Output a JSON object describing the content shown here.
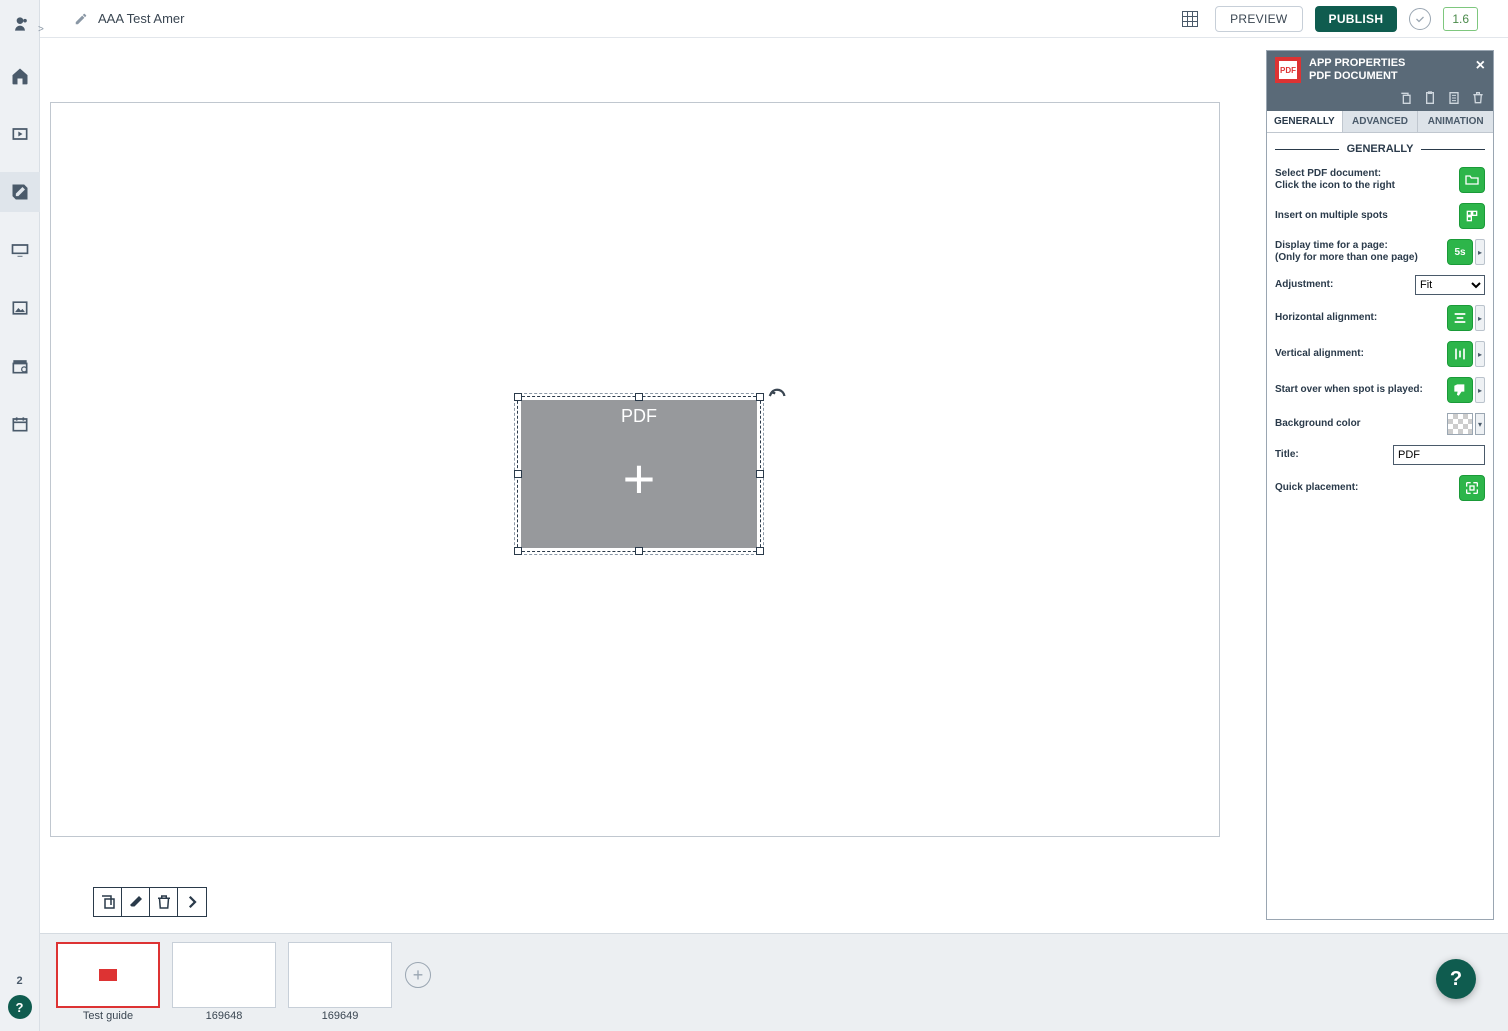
{
  "topbar": {
    "doc_title": "AAA Test Amer",
    "preview_label": "PREVIEW",
    "publish_label": "PUBLISH",
    "version": "1.6"
  },
  "sidebar": {
    "badge": "2"
  },
  "canvas": {
    "element_label": "PDF"
  },
  "spots": [
    {
      "label": "Test guide",
      "active": true,
      "has_pdf": true
    },
    {
      "label": "169648",
      "active": false,
      "has_pdf": false
    },
    {
      "label": "169649",
      "active": false,
      "has_pdf": false
    }
  ],
  "props": {
    "header_line1": "APP PROPERTIES",
    "header_line2": "PDF DOCUMENT",
    "tabs": {
      "generally": "GENERALLY",
      "advanced": "ADVANCED",
      "animation": "ANIMATION"
    },
    "section_title": "GENERALLY",
    "rows": {
      "select_pdf_l1": "Select PDF document:",
      "select_pdf_l2": "Click the icon to the right",
      "insert_multi": "Insert on multiple spots",
      "display_time_l1": "Display time for a page:",
      "display_time_l2": "(Only for more than one page)",
      "display_time_value": "5s",
      "adjustment": "Adjustment:",
      "adjustment_value": "Fit",
      "h_align": "Horizontal alignment:",
      "v_align": "Vertical alignment:",
      "start_over": "Start over when spot is played:",
      "bg_color": "Background color",
      "title_label": "Title:",
      "title_value": "PDF",
      "quick_placement": "Quick placement:"
    }
  }
}
